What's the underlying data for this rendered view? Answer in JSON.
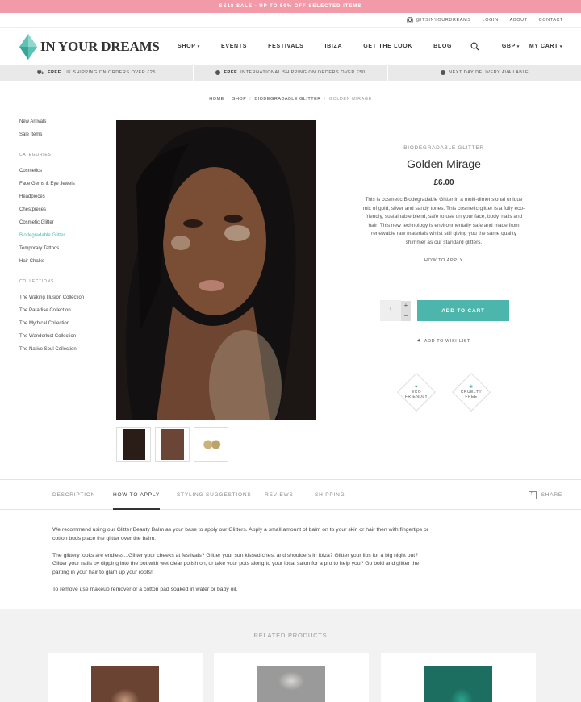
{
  "promo": "SS18 SALE - UP TO 50% OFF SELECTED ITEMS",
  "util": {
    "instagram": "@ITSINYOURDREAMS",
    "login": "LOGIN",
    "about": "ABOUT",
    "contact": "CONTACT"
  },
  "logo": "IN YOUR DREAMS",
  "nav": [
    "SHOP",
    "EVENTS",
    "FESTIVALS",
    "IBIZA",
    "GET THE LOOK",
    "BLOG"
  ],
  "header": {
    "currency": "GBP",
    "cart": "MY CART"
  },
  "ship": [
    {
      "bold": "FREE",
      "text": "UK SHIPPING ON ORDERS OVER £25"
    },
    {
      "bold": "FREE",
      "text": "INTERNATIONAL SHIPPING ON ORDERS OVER £50"
    },
    {
      "bold": "",
      "text": "NEXT DAY DELIVERY AVAILABLE"
    }
  ],
  "breadcrumb": [
    "HOME",
    "SHOP",
    "BIODEGRADABLE GLITTER",
    "GOLDEN MIRAGE"
  ],
  "sidebar": {
    "top": [
      "New Arrivals",
      "Sale Items"
    ],
    "categories_head": "CATEGORIES",
    "categories": [
      "Cosmetics",
      "Face Gems & Eye Jewels",
      "Headpieces",
      "Chestpieces",
      "Cosmetic Glitter",
      "Biodegradable Glitter",
      "Temporary Tattoos",
      "Hair Chalks"
    ],
    "collections_head": "COLLECTIONS",
    "collections": [
      "The Waking Illusion Collection",
      "The Paradise Collection",
      "The Mythical Collection",
      "The Wanderlust Collection",
      "The Native Soul Collection"
    ]
  },
  "product": {
    "category": "BIODEGRADABLE GLITTER",
    "name": "Golden Mirage",
    "price": "£6.00",
    "description": "This is cosmetic Biodegradable Glitter in a multi-dimensional unique mix of gold, silver and sandy tones. This cosmetic glitter is a fully eco-friendly, sustainable blend, safe to use on your face, body, nails and hair! This new technology is environmentally safe and made from renewable raw materials whilst still giving you the same quality shimmer as our standard glitters.",
    "how_to": "HOW TO APPLY",
    "qty": "1",
    "add_to_cart": "ADD TO CART",
    "wishlist": "ADD TO WISHLIST",
    "badge1": [
      "ECO",
      "FRIENDLY"
    ],
    "badge2": [
      "CRUELTY",
      "FREE"
    ]
  },
  "tabs": [
    "DESCRIPTION",
    "HOW TO APPLY",
    "STYLING SUGGESTIONS",
    "REVIEWS",
    "SHIPPING"
  ],
  "share": "SHARE",
  "content": [
    "We recommend using our Glitter Beauty Balm as your base to apply our Glitters. Apply a small amount of balm on to your skin or hair then with fingertips or cotton buds place the glitter over the balm.",
    "The glittery looks are endless...Glitter your cheeks at festivals? Glitter your sun kissed chest and shoulders in Ibiza? Glitter your lips for a big night out? Glitter your nails by dipping into the pot with wet clear polish on, or take your pots along to your local salon for a pro to help you? Go bold and glitter the parting in your hair to glam up your roots!",
    "To remove use makeup remover or a cotton pad soaked in water or baby oil."
  ],
  "related_title": "RELATED PRODUCTS",
  "colors": {
    "promo": "#f29aa7",
    "accent": "#4db6ac",
    "logo": "#5bc3b6"
  }
}
